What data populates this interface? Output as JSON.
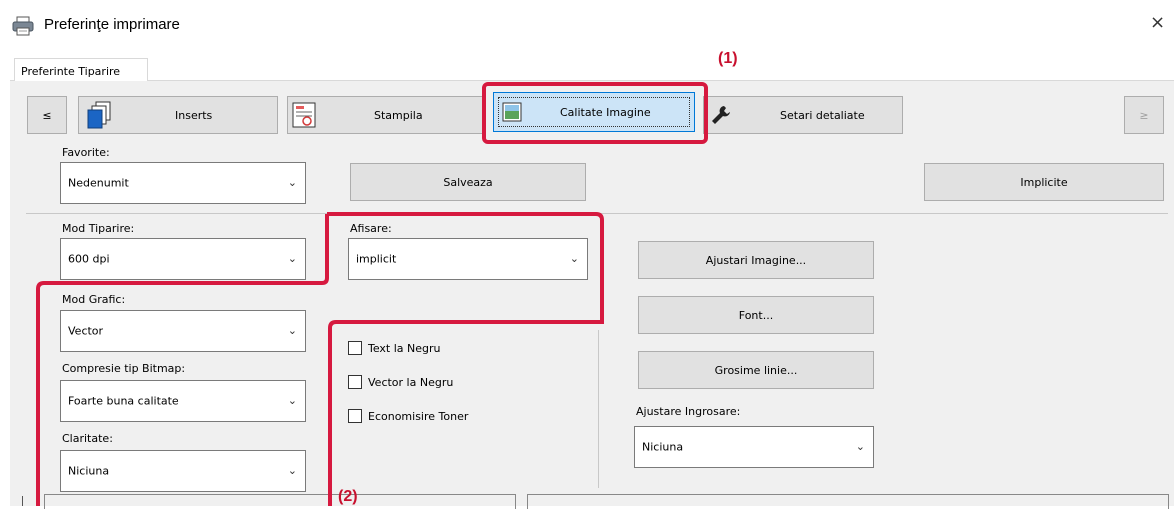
{
  "window": {
    "title": "Preferinţe imprimare",
    "close_glyph": "×"
  },
  "tabs": [
    {
      "label": "Preferinte Tiparire"
    }
  ],
  "toolbar": {
    "prev_glyph": "≤",
    "next_glyph": "≥",
    "inserts_label": "Inserts",
    "stampila_label": "Stampila",
    "calitate_label": "Calitate Imagine",
    "setari_label": "Setari detaliate"
  },
  "favorite": {
    "label": "Favorite:",
    "value": "Nedenumit",
    "save_label": "Salveaza",
    "defaults_label": "Implicite"
  },
  "mod_tiparire": {
    "label": "Mod Tiparire:",
    "value": "600 dpi"
  },
  "afisare": {
    "label": "Afisare:",
    "value": "implicit"
  },
  "mod_grafic": {
    "label": "Mod Grafic:",
    "value": "Vector"
  },
  "compresie": {
    "label": "Compresie tip Bitmap:",
    "value": "Foarte buna calitate"
  },
  "claritate": {
    "label": "Claritate:",
    "value": "Niciuna"
  },
  "checkboxes": {
    "text_negru": "Text la Negru",
    "vector_negru": "Vector la Negru",
    "economisire": "Economisire Toner"
  },
  "right_buttons": {
    "ajustari": "Ajustari Imagine...",
    "font": "Font...",
    "grosime": "Grosime linie..."
  },
  "ajustare_ingrosare": {
    "label": "Ajustare Ingrosare:",
    "value": "Niciuna"
  },
  "callouts": {
    "one": "(1)",
    "two": "(2)"
  },
  "colors": {
    "callout": "#c8102e",
    "highlight_box": "#d6193f",
    "panel_bg": "#f0f0f0",
    "selected_btn": "#cce4f7"
  }
}
